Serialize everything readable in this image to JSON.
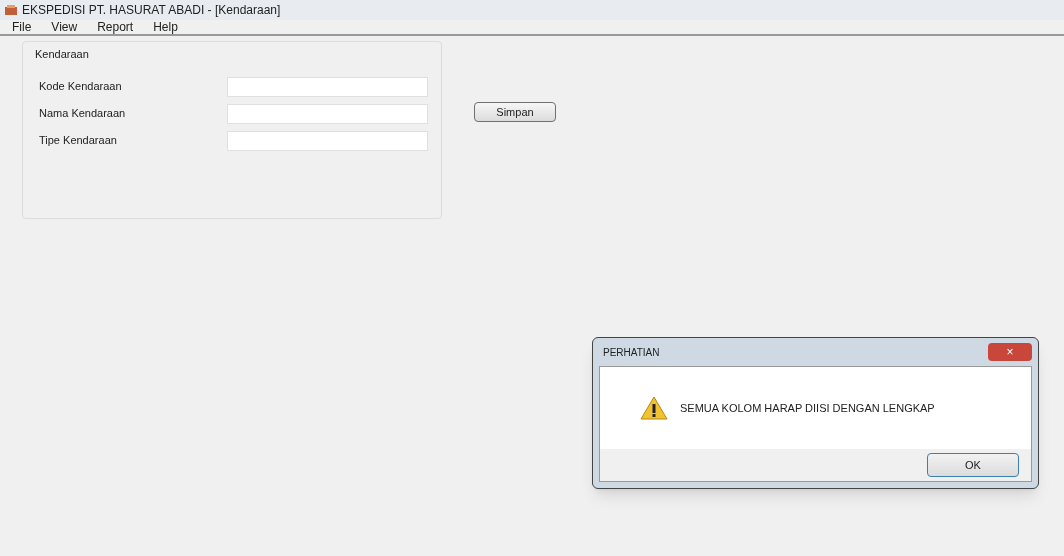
{
  "window": {
    "title": "EKSPEDISI PT. HASURAT ABADI - [Kendaraan]"
  },
  "menu": [
    "File",
    "View",
    "Report",
    "Help"
  ],
  "group": {
    "title": "Kendaraan",
    "fields": [
      {
        "label": "Kode Kendaraan"
      },
      {
        "label": "Nama Kendaraan"
      },
      {
        "label": "Tipe Kendaraan"
      }
    ]
  },
  "save_button": "Simpan",
  "dialog": {
    "title": "PERHATIAN",
    "close": "×",
    "message": "SEMUA KOLOM HARAP DIISI DENGAN LENGKAP",
    "button": "OK"
  }
}
